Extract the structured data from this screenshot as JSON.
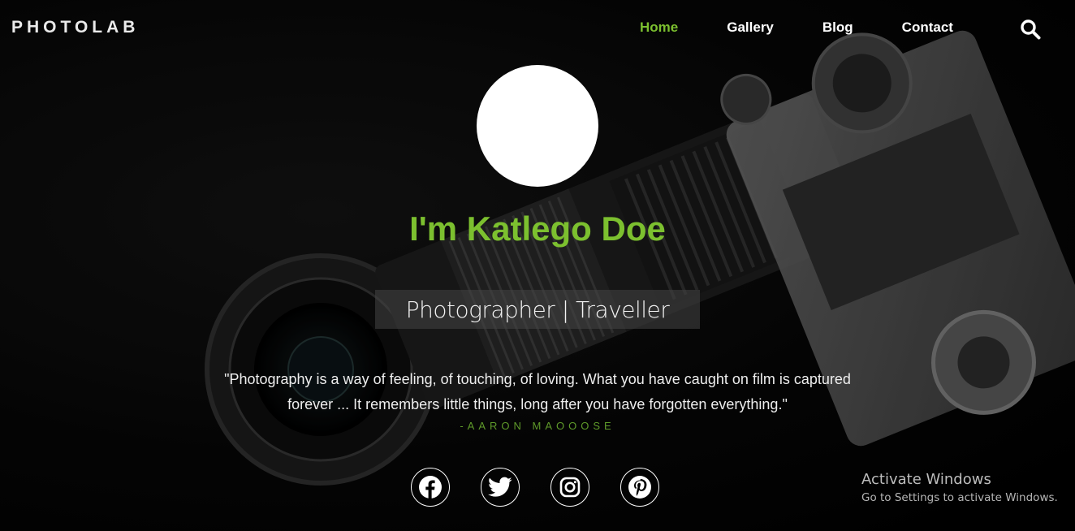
{
  "brand": {
    "logo_text": "PHOTOLAB"
  },
  "nav": {
    "items": [
      {
        "label": "Home",
        "active": true
      },
      {
        "label": "Gallery",
        "active": false
      },
      {
        "label": "Blog",
        "active": false
      },
      {
        "label": "Contact",
        "active": false
      }
    ],
    "search_icon": "search-icon"
  },
  "hero": {
    "name": "I'm Katlego Doe",
    "role": "Photographer | Traveller",
    "quote": "\"Photography is a way of feeling, of touching, of loving. What you have caught on film is captured forever ... It remembers little things, long after you have forgotten everything.\"",
    "author": "-AARON MAOOOSE"
  },
  "socials": [
    {
      "icon": "facebook-icon"
    },
    {
      "icon": "twitter-icon"
    },
    {
      "icon": "instagram-icon"
    },
    {
      "icon": "pinterest-icon"
    }
  ],
  "watermark": {
    "title": "Activate Windows",
    "subtitle": "Go to Settings to activate Windows."
  },
  "colors": {
    "accent": "#7cc02f",
    "author": "#5f9a2a",
    "background": "#000000"
  }
}
